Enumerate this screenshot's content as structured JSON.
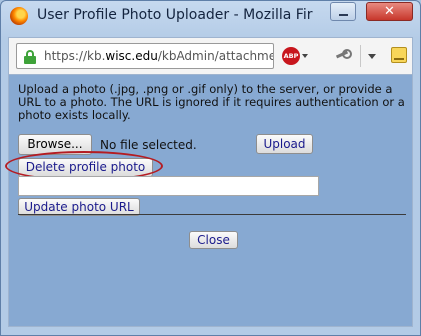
{
  "window": {
    "title": "User Profile Photo Uploader - Mozilla Fir",
    "close_label": "✕"
  },
  "navbar": {
    "url_prefix": "https://kb.",
    "url_domain": "wisc.edu",
    "url_path": "/kbAdmin/attachmer",
    "abp_label": "ABP"
  },
  "content": {
    "instructions": "Upload a photo (.jpg, .png or .gif only) to the server, or provide a URL to a photo. The URL is ignored if it requires authentication or a photo exists locally.",
    "browse_label": "Browse...",
    "file_status": "No file selected.",
    "upload_label": "Upload",
    "delete_label": "Delete profile photo",
    "url_value": "",
    "update_label": "Update photo URL",
    "close_label": "Close"
  },
  "colors": {
    "content_background": "#87a9d2",
    "highlight_ellipse": "#b41c22",
    "title_bar": "#b3cbe6",
    "abp_red": "#c8161d",
    "lock_green": "#3fa33a"
  },
  "icons": [
    "firefox-logo-icon",
    "minimize-icon",
    "close-icon",
    "lock-icon",
    "adblock-plus-icon",
    "dropdown-arrow-icon",
    "tools-icon",
    "menu-arrow-icon",
    "bookmark-icon"
  ]
}
